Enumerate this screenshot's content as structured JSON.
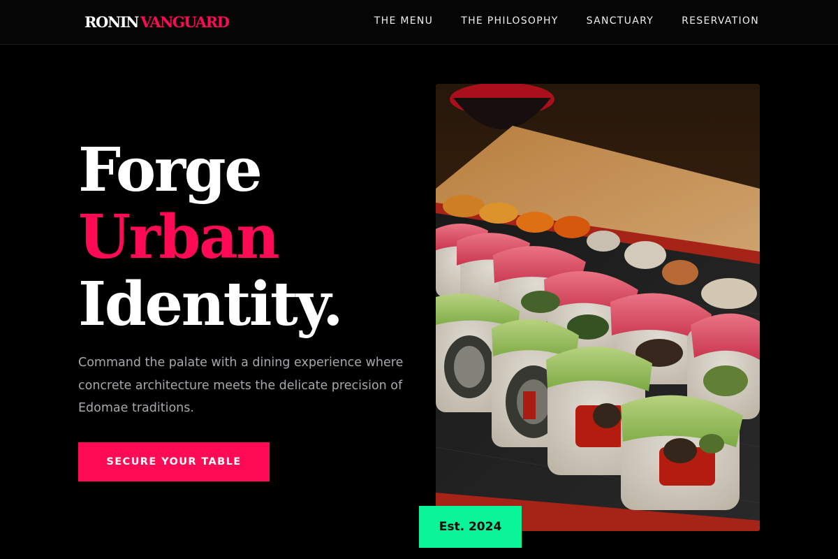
{
  "brand": {
    "part1": "RONIN",
    "part2": "VANGUARD"
  },
  "nav": {
    "items": [
      "THE MENU",
      "THE PHILOSOPHY",
      "SANCTUARY",
      "RESERVATION"
    ]
  },
  "hero": {
    "line1": "Forge",
    "line2": "Urban",
    "line3": "Identity.",
    "subtitle": "Command the palate with a dining experience where concrete architecture meets the delicate precision of Edomae traditions.",
    "cta_label": "SECURE YOUR TABLE",
    "badge": "Est. 2024",
    "image_alt": "Sushi rolls with tuna and avocado on a black lacquered tray"
  },
  "colors": {
    "accent": "#ff0a55",
    "badge": "#0af59a",
    "background": "#000000"
  }
}
